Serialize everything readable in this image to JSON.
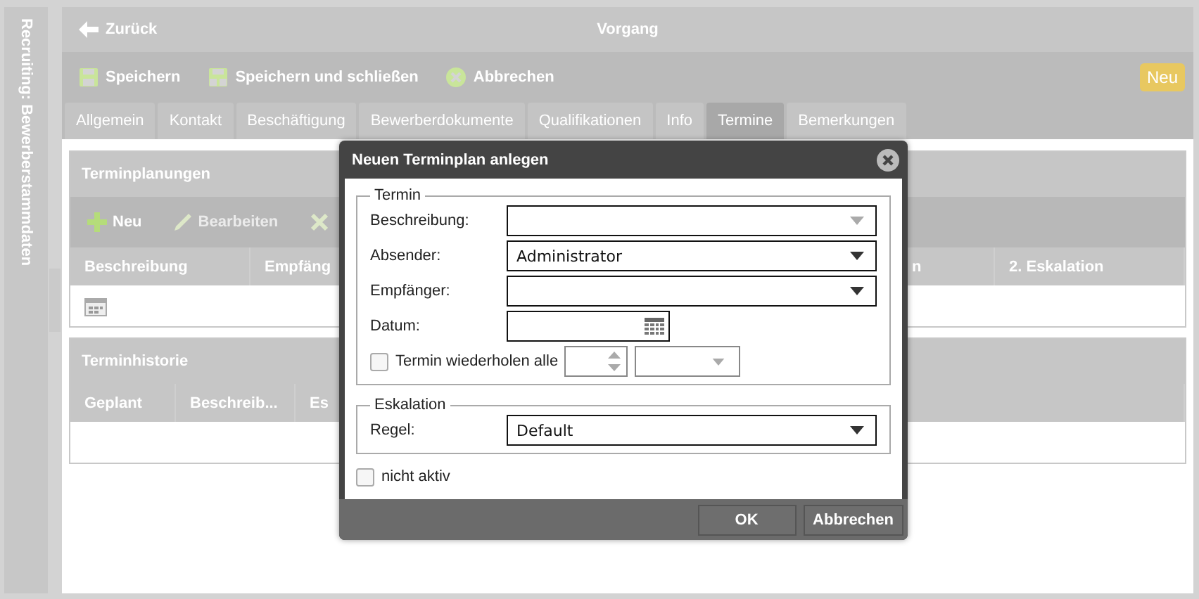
{
  "sidebar": {
    "title": "Recruiting: Bewerberstammdaten"
  },
  "header": {
    "back": "Zurück",
    "title": "Vorgang"
  },
  "toolbar": {
    "buttons": [
      {
        "kind": "save",
        "label": "Speichern"
      },
      {
        "kind": "save_close",
        "label": "Speichern und schließen"
      },
      {
        "kind": "cancel",
        "label": "Abbrechen"
      }
    ],
    "badge": "Neu"
  },
  "tabs": [
    {
      "label": "Allgemein",
      "selected": false
    },
    {
      "label": "Kontakt",
      "selected": false
    },
    {
      "label": "Beschäftigung",
      "selected": false
    },
    {
      "label": "Bewerberdokumente",
      "selected": false
    },
    {
      "label": "Qualifikationen",
      "selected": false
    },
    {
      "label": "Info",
      "selected": false
    },
    {
      "label": "Termine",
      "selected": true
    },
    {
      "label": "Bemerkungen",
      "selected": false
    }
  ],
  "sections": [
    {
      "title": "Terminplanungen",
      "actions": [
        {
          "kind": "add",
          "label": "Neu",
          "disabled": false
        },
        {
          "kind": "edit",
          "label": "Bearbeiten",
          "disabled": true
        },
        {
          "kind": "delete",
          "disabled": true
        }
      ],
      "columns": [
        "Beschreibung",
        "Empfäng",
        "n",
        "2. Eskalation"
      ],
      "rows": [
        {
          "kind": "new_entry"
        }
      ]
    },
    {
      "title": "Terminhistorie",
      "columns": [
        "Geplant",
        "Beschreib...",
        "Es"
      ]
    }
  ],
  "dialog": {
    "title": "Neuen Terminplan anlegen",
    "groups": [
      {
        "legend": "Termin",
        "fields": [
          {
            "kind": "combo",
            "label": "Beschreibung:",
            "editable": true
          },
          {
            "kind": "combo",
            "label": "Absender:",
            "value": "Administrator",
            "editable": false
          },
          {
            "kind": "combo",
            "label": "Empfänger:",
            "editable": false
          },
          {
            "kind": "date",
            "label": "Datum:"
          },
          {
            "kind": "repeat",
            "label": "Termin wiederholen alle",
            "checked": false,
            "disabled": true
          }
        ]
      },
      {
        "legend": "Eskalation",
        "fields": [
          {
            "kind": "combo",
            "label": "Regel:",
            "value": "Default",
            "editable": false
          }
        ]
      }
    ],
    "inactive": {
      "label": "nicht aktiv",
      "checked": false
    },
    "buttons": [
      "OK",
      "Abbrechen"
    ]
  }
}
